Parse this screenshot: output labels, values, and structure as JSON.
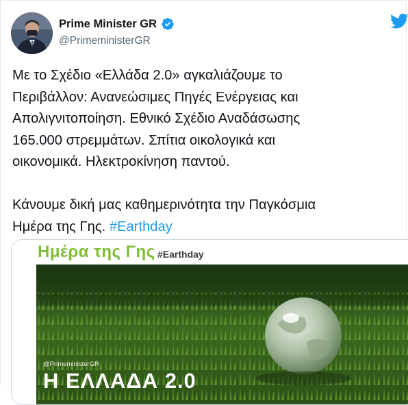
{
  "author": {
    "display_name": "Prime Minister GR",
    "handle": "@PrimeministerGR"
  },
  "tweet": {
    "text_main": "Με το Σχέδιο «Ελλάδα 2.0» αγκαλιάζουμε το\nΠεριβάλλον: Ανανεώσιμες Πηγές Ενέργειας και\nΑπολιγνιτοποίηση. Εθνικό Σχέδιο Αναδάσωσης\n165.000 στρεμμάτων. Σπίτια οικολογικά και\nοικονομικά. Ηλεκτροκίνηση παντού.\n\nΚάνουμε δική μας καθημερινότητα την Παγκόσμια\nΗμέρα της Γης. ",
    "hashtag": "#Earthday"
  },
  "media": {
    "banner_title": "Ημέρα της Γης",
    "banner_tag": "#Earthday",
    "credit": "@PrimeministerGR",
    "caption": "Η ΕΛΛΑΔΑ 2.0"
  },
  "colors": {
    "accent": "#1d9bf0",
    "banner_green": "#7dbe34"
  },
  "icons": {
    "verified": "verified-badge-icon",
    "brand": "twitter-bird-icon"
  }
}
